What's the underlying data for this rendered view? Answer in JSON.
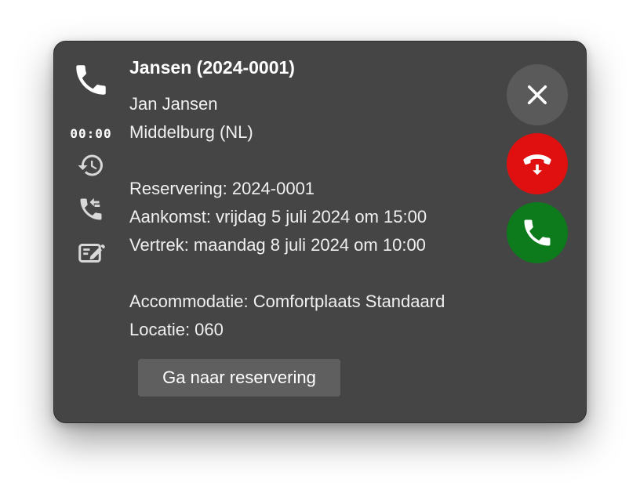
{
  "call": {
    "timer": "00:00"
  },
  "contact": {
    "title": "Jansen (2024-0001)",
    "name": "Jan  Jansen",
    "location": "Middelburg (NL)"
  },
  "reservation": {
    "reservering": "Reservering: 2024-0001",
    "aankomst": "Aankomst: vrijdag 5 juli 2024 om 15:00",
    "vertrek": "Vertrek: maandag 8 juli 2024 om 10:00",
    "accommodatie": "Accommodatie: Comfortplaats Standaard",
    "locatie": "Locatie: 060"
  },
  "actions": {
    "goto_reservation": "Ga naar reservering"
  },
  "icons": {
    "call": "phone-icon",
    "history": "history-icon",
    "callback": "phone-callback-icon",
    "note": "edit-note-icon",
    "close": "close-icon",
    "decline": "hangup-icon",
    "accept": "phone-accept-icon"
  },
  "colors": {
    "panel": "#454545",
    "close_button": "#5a5a5a",
    "decline_button": "#e01010",
    "accept_button": "#0d7a1c"
  }
}
